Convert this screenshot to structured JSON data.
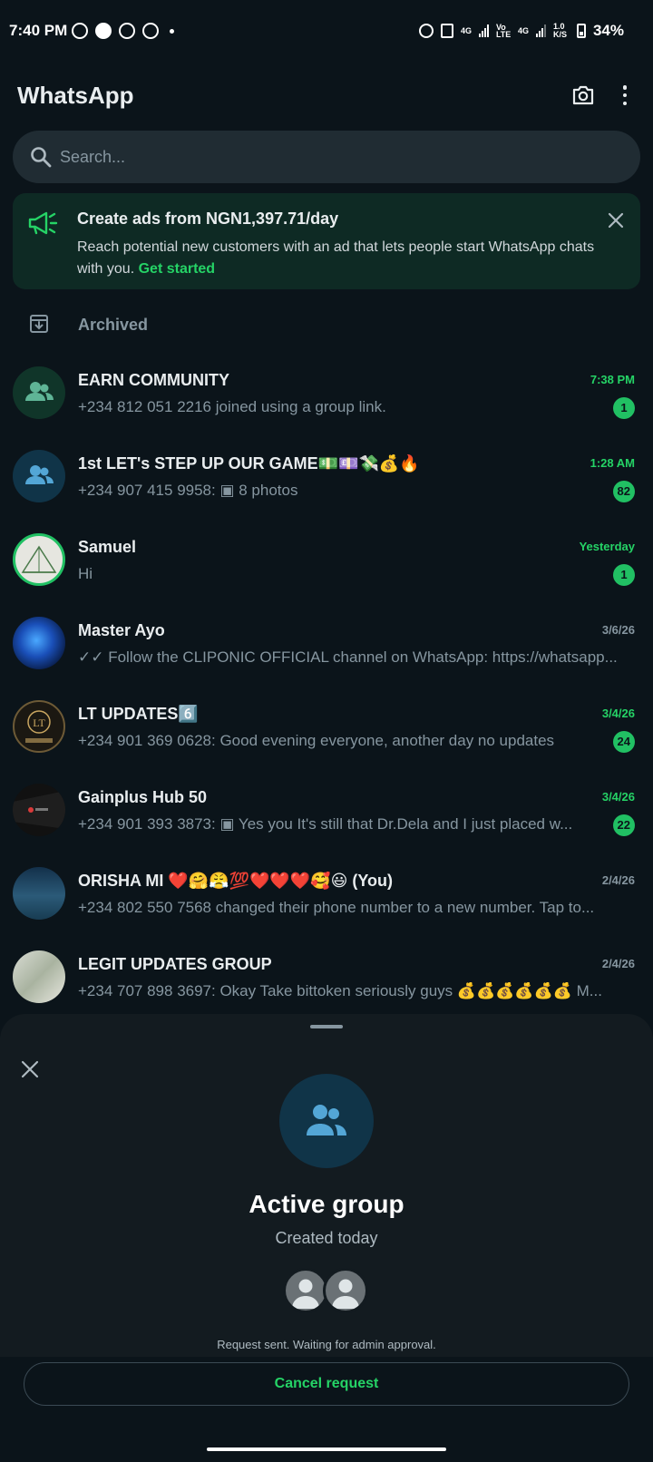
{
  "status_bar": {
    "time": "7:40 PM",
    "net_left": "4G",
    "volte": "Vo LTE",
    "net_right": "4G",
    "speed": "1.0 K/S",
    "battery": "34%"
  },
  "app_bar": {
    "title": "WhatsApp"
  },
  "search": {
    "placeholder": "Search..."
  },
  "ad_banner": {
    "title": "Create ads from NGN1,397.71/day",
    "body": "Reach potential new customers with an ad that lets people start WhatsApp chats with you.",
    "link": "Get started"
  },
  "archived": {
    "label": "Archived"
  },
  "chats": [
    {
      "name": "EARN COMMUNITY",
      "preview": "+234 812 051 2216 joined using a group link.",
      "time": "7:38 PM",
      "unread": "1"
    },
    {
      "name": "1st LET's STEP UP OUR GAME💵💷💸💰🔥",
      "preview": "+234 907 415 9958: ▣ 8 photos",
      "time": "1:28 AM",
      "unread": "82"
    },
    {
      "name": "Samuel",
      "preview": "Hi",
      "time": "Yesterday",
      "unread": "1"
    },
    {
      "name": "Master Ayo",
      "preview": "✓✓ Follow the CLIPONIC OFFICIAL  channel on WhatsApp: https://whatsapp...",
      "time": "3/6/26",
      "unread": ""
    },
    {
      "name": "LT UPDATES6️⃣",
      "preview": "+234 901 369 0628: Good evening everyone, another day no updates",
      "time": "3/4/26",
      "unread": "24"
    },
    {
      "name": "Gainplus Hub 50",
      "preview": "+234 901 393 3873: ▣ Yes you   It's still that Dr.Dela and I just placed w...",
      "time": "3/4/26",
      "unread": "22"
    },
    {
      "name": "ORISHA MI ❤️🤗😤💯❤️❤️❤️🥰😃 (You)",
      "preview": "+234 802 550 7568 changed their phone number to a new number. Tap to...",
      "time": "2/4/26",
      "unread": ""
    },
    {
      "name": "LEGIT UPDATES GROUP",
      "preview": "+234 707 898 3697: Okay  Take bittoken seriously guys 💰💰💰💰💰💰  M...",
      "time": "2/4/26",
      "unread": ""
    }
  ],
  "sheet": {
    "group_name": "Active group",
    "subtitle": "Created today",
    "note": "Request sent. Waiting for admin approval.",
    "cancel_label": "Cancel request"
  },
  "colors": {
    "accent": "#25d366",
    "background": "#0b141a",
    "surface": "#202c33"
  }
}
